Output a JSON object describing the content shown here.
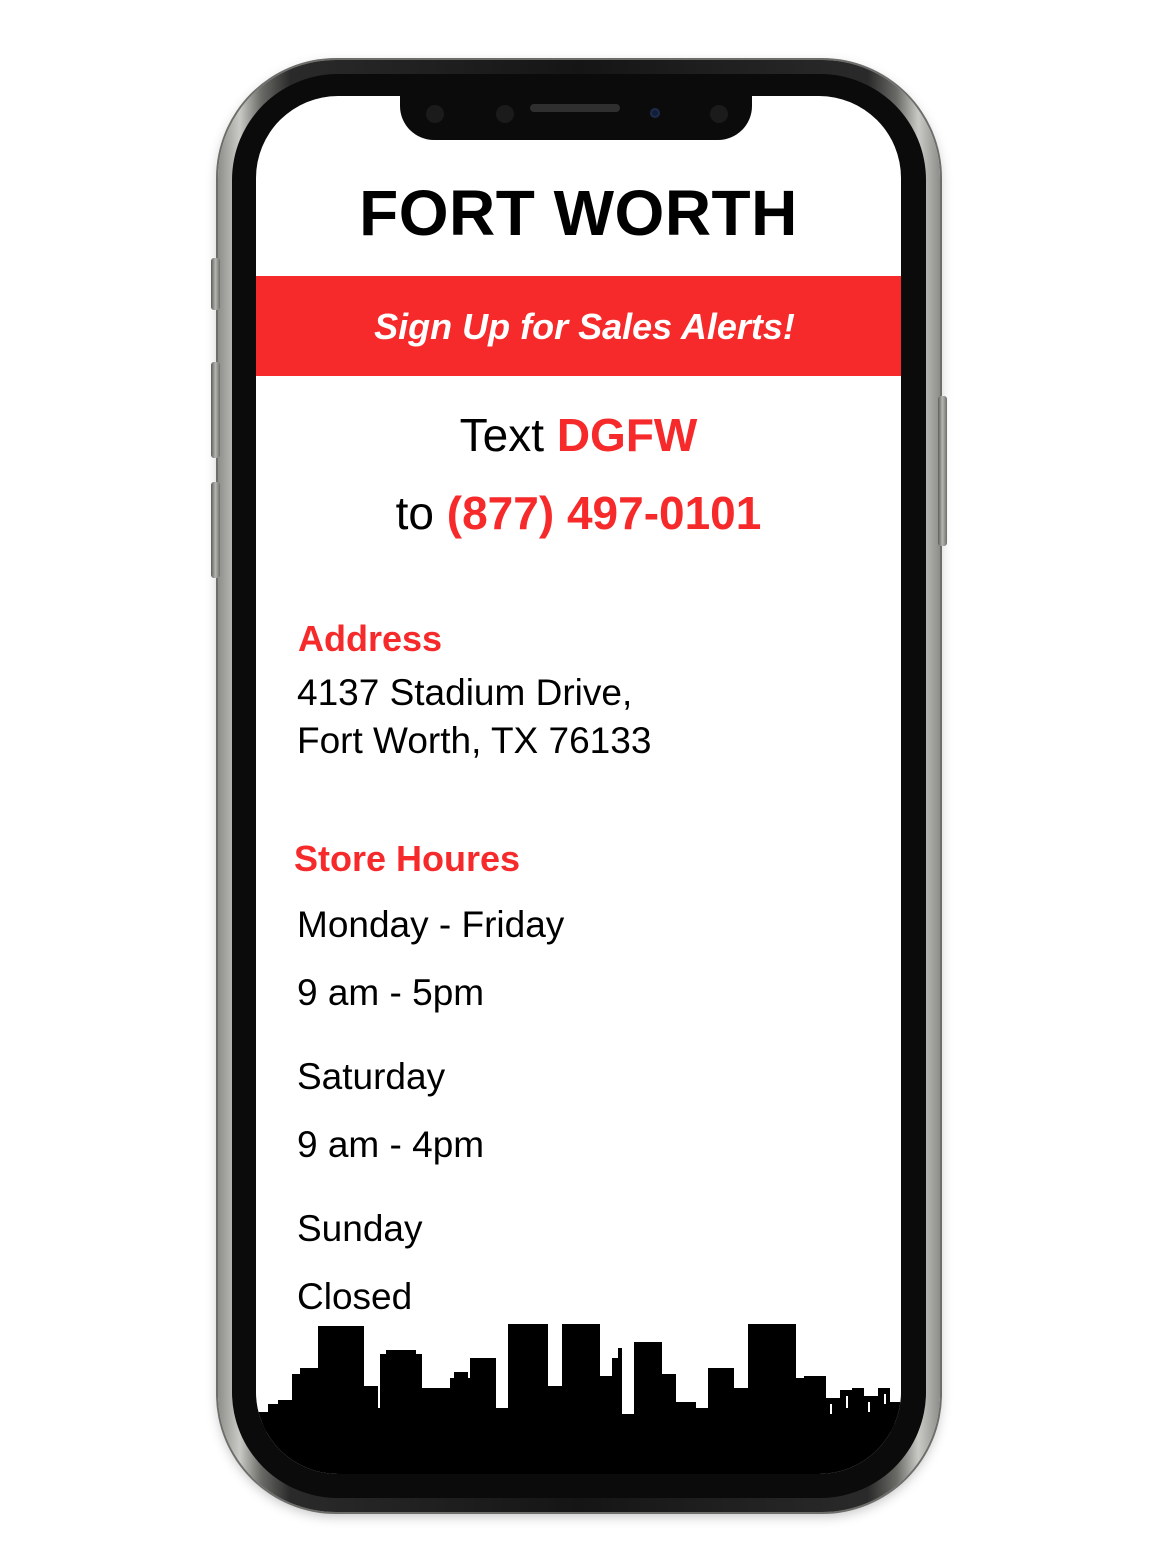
{
  "title": "FORT WORTH",
  "banner": {
    "label": "Sign Up for Sales Alerts!",
    "color": "#f62a2a"
  },
  "sms": {
    "text_prefix": "Text",
    "keyword": "DGFW",
    "to_prefix": "to",
    "phone": "(877) 497-0101"
  },
  "address": {
    "heading": "Address",
    "line1": "4137 Stadium Drive,",
    "line2": "Fort Worth, TX 76133"
  },
  "hours": {
    "heading": "Store Houres",
    "entries": [
      {
        "day": "Monday - Friday",
        "time": "9 am - 5pm"
      },
      {
        "day": "Saturday",
        "time": "9 am - 4pm"
      },
      {
        "day": "Sunday",
        "time": "Closed"
      }
    ]
  },
  "colors": {
    "accent": "#f62a2a",
    "text": "#000000",
    "phone_frame": "#151515"
  },
  "icons": {
    "decoration": "city-skyline"
  }
}
